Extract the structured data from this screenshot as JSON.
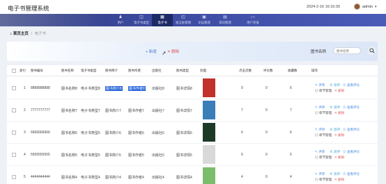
{
  "header": {
    "app_title": "电子书管理系统",
    "datetime": "2024-2-16 16:16:30",
    "user": "admin",
    "user_caret": "▾"
  },
  "nav": [
    {
      "label": "用户",
      "icon": "user-icon"
    },
    {
      "label": "电子书类型",
      "icon": "tag-icon"
    },
    {
      "label": "电子书",
      "icon": "grid-icon",
      "active": true
    },
    {
      "label": "留言板管理",
      "icon": "message-icon"
    },
    {
      "label": "论坛管理",
      "icon": "forum-icon"
    },
    {
      "label": "资讯管理",
      "icon": "news-icon"
    },
    {
      "label": "用户充值",
      "icon": "calendar-icon"
    }
  ],
  "breadcrumb": {
    "home": "首页主页",
    "sep": "/",
    "current": "电子书"
  },
  "toolbar": {
    "add_label": "+ 新增",
    "delete_label": "✕ 删除",
    "search_label": "图书名称",
    "search_placeholder": "图书名称"
  },
  "table": {
    "columns": [
      "索引",
      "图书编号",
      "图书名称",
      "电子书类型",
      "图书简介",
      "图书作者",
      "出版社",
      "图书类型",
      "封面",
      "点击次数",
      "评论数",
      "收藏数",
      "操作"
    ],
    "rows": [
      {
        "index": "1",
        "code": "8888888888",
        "name": "图书名称8",
        "type": "电子书类型8",
        "intro": "图书简介8",
        "author": "图书作者8",
        "publisher": "出版社8",
        "category": "图书详情8",
        "clicks": "9",
        "comments": "0",
        "favorites": "6",
        "highlight": true,
        "cover": "#c0322b"
      },
      {
        "index": "2",
        "code": "7777777777",
        "name": "图书名称7",
        "type": "电子书类型7",
        "intro": "图书简介7",
        "author": "图书作者7",
        "publisher": "出版社7",
        "category": "图书详情7",
        "clicks": "7",
        "comments": "0",
        "favorites": "7",
        "highlight": false,
        "cover": "#3a7fb8"
      },
      {
        "index": "3",
        "code": "6666666666",
        "name": "图书名称6",
        "type": "电子书类型6",
        "intro": "图书简介6",
        "author": "图书作者6",
        "publisher": "出版社6",
        "category": "图书详情6",
        "clicks": "6",
        "comments": "0",
        "favorites": "6",
        "highlight": false,
        "cover": "#1d3a26"
      },
      {
        "index": "4",
        "code": "5555555555",
        "name": "图书名称5",
        "type": "电子书类型5",
        "intro": "图书简介5",
        "author": "图书作者5",
        "publisher": "出版社5",
        "category": "图书详情5",
        "clicks": "5",
        "comments": "0",
        "favorites": "5",
        "highlight": false,
        "cover": "#d9d9d9"
      },
      {
        "index": "5",
        "code": "4444444444",
        "name": "图书名称4",
        "type": "电子书类型4",
        "intro": "图书简介4",
        "author": "图书作者4",
        "publisher": "出版社4",
        "category": "图书详情4",
        "clicks": "4",
        "comments": "0",
        "favorites": "4",
        "highlight": false,
        "cover": "#7bbd6a"
      }
    ],
    "actions": {
      "edit": "✎ 评审",
      "detail": "⊗ 测评",
      "comment": "⊙ 查看评论",
      "chapter": "▤ 章节管理",
      "delete": "✕ 删除"
    }
  }
}
